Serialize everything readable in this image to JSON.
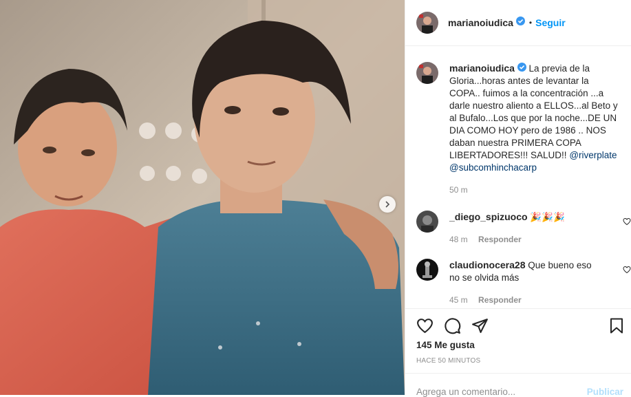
{
  "post": {
    "author": "marianoiudica",
    "separator": "•",
    "follow_label": "Seguir",
    "caption": {
      "author": "marianoiudica",
      "text": "La previa de la Gloria...horas antes de levantar la COPA.. fuimos a la concentración ...a darle nuestro aliento a ELLOS...al Beto y al Bufalo...Los que por la noche...DE UN DIA COMO HOY pero de 1986 .. NOS daban nuestra PRIMERA COPA LIBERTADORES!!! SALUD!!",
      "mention1": "@riverplate",
      "mention2": "@subcomhinchacarp",
      "time": "50 m"
    },
    "comments": [
      {
        "user": "_diego_spizuoco",
        "text": "🎉🎉🎉",
        "time": "48 m",
        "reply_label": "Responder"
      },
      {
        "user": "claudionocera28",
        "text": "Que bueno eso no se olvida más",
        "time": "45 m",
        "reply_label": "Responder"
      }
    ],
    "likes": "145 Me gusta",
    "date": "HACE 50 MINUTOS",
    "add_comment_placeholder": "Agrega un comentario...",
    "publish_label": "Publicar"
  },
  "colors": {
    "accent": "#0095f6",
    "verified": "#3897f0",
    "link": "#00376b",
    "muted": "#8e8e8e"
  }
}
